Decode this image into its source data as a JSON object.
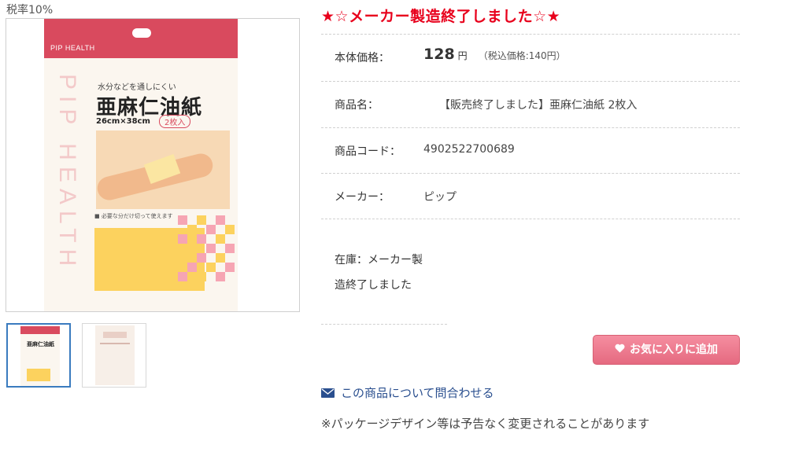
{
  "tax_rate": "税率10%",
  "product_image": {
    "brand": "PIP HEALTH",
    "vertical_text": "PIP HEALTH",
    "subtitle": "水分などを通しにくい",
    "title": "亜麻仁油紙",
    "size": "26cm×38cm",
    "count": "2枚入",
    "note": "■ 必要な分だけ切って使えます",
    "thumb_title": "亜麻仁油紙"
  },
  "headline": "★☆メーカー製造終了しました☆★",
  "specs": {
    "price_label": "本体価格：",
    "price_value": "128",
    "price_unit": "円",
    "price_tax": "（税込価格:140円）",
    "name_label": "商品名：",
    "name_value": "【販売終了しました】亜麻仁油紙 2枚入",
    "code_label": "商品コード：",
    "code_value": "4902522700689",
    "maker_label": "メーカー：",
    "maker_value": "ピップ",
    "stock_text": "在庫：メーカー製造終了しました"
  },
  "actions": {
    "favorite_label": "お気に入りに追加",
    "contact_label": "この商品について問合わせる"
  },
  "notice": "※パッケージデザイン等は予告なく変更されることがあります",
  "icons": {
    "favorite": "heart-icon",
    "contact": "mail-icon"
  },
  "colors": {
    "headline": "#e8001c",
    "favorite_button": "#e56a80",
    "link": "#2a4f8f"
  }
}
